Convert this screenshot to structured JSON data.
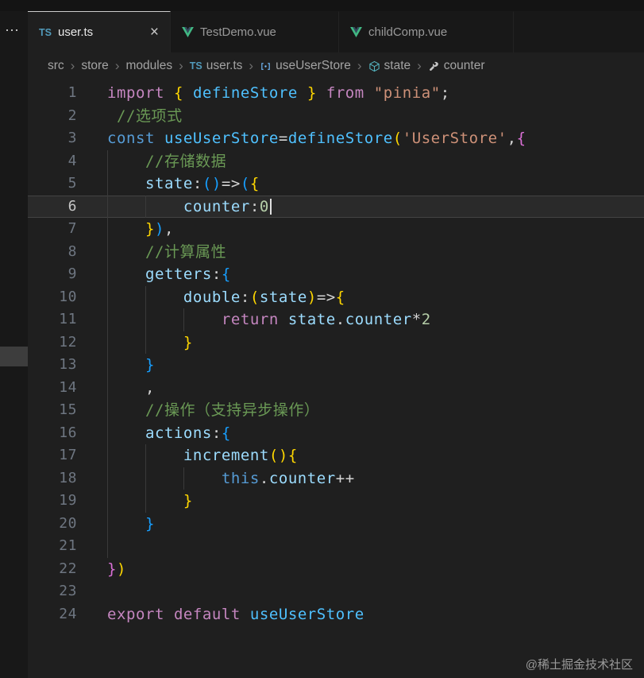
{
  "activity_bar": {
    "overflow_label": "⋯"
  },
  "icons": {
    "ts_label": "TS"
  },
  "tab_bar": {
    "tabs": [
      {
        "label": "user.ts",
        "icon": "ts",
        "active": true,
        "close_label": "×"
      },
      {
        "label": "TestDemo.vue",
        "icon": "vue",
        "active": false
      },
      {
        "label": "childComp.vue",
        "icon": "vue",
        "active": false
      }
    ]
  },
  "breadcrumb": {
    "separator": "›",
    "items": [
      {
        "label": "src"
      },
      {
        "label": "store"
      },
      {
        "label": "modules"
      },
      {
        "label": "user.ts",
        "icon": "ts"
      },
      {
        "label": "useUserStore",
        "icon": "symbol-variable"
      },
      {
        "label": "state",
        "icon": "symbol-cube"
      },
      {
        "label": "counter",
        "icon": "symbol-wrench"
      }
    ]
  },
  "editor": {
    "active_line": 6,
    "lines": [
      {
        "n": 1,
        "t": [
          [
            "kw",
            "import"
          ],
          [
            "pl",
            " "
          ],
          [
            "b1",
            "{"
          ],
          [
            "pl",
            " "
          ],
          [
            "vr",
            "defineStore"
          ],
          [
            "pl",
            " "
          ],
          [
            "b1",
            "}"
          ],
          [
            "pl",
            " "
          ],
          [
            "kw",
            "from"
          ],
          [
            "pl",
            " "
          ],
          [
            "str",
            "\"pinia\""
          ],
          [
            "pl",
            ";"
          ]
        ]
      },
      {
        "n": 2,
        "t": [
          [
            "pl",
            " "
          ],
          [
            "cm",
            "//选项式"
          ]
        ]
      },
      {
        "n": 3,
        "t": [
          [
            "st",
            "const"
          ],
          [
            "pl",
            " "
          ],
          [
            "vr",
            "useUserStore"
          ],
          [
            "pl",
            "="
          ],
          [
            "vr",
            "defineStore"
          ],
          [
            "b1",
            "("
          ],
          [
            "str",
            "'UserStore'"
          ],
          [
            "pl",
            ","
          ],
          [
            "b2",
            "{"
          ]
        ]
      },
      {
        "n": 4,
        "t": [
          [
            "pl",
            "    "
          ],
          [
            "cm",
            "//存储数据"
          ]
        ]
      },
      {
        "n": 5,
        "t": [
          [
            "pl",
            "    "
          ],
          [
            "pr",
            "state"
          ],
          [
            "pl",
            ":"
          ],
          [
            "b3",
            "()"
          ],
          [
            "pl",
            "=>"
          ],
          [
            "b3",
            "("
          ],
          [
            "b1",
            "{"
          ]
        ]
      },
      {
        "n": 6,
        "t": [
          [
            "pl",
            "        "
          ],
          [
            "pr",
            "counter"
          ],
          [
            "pl",
            ":"
          ],
          [
            "num",
            "0"
          ]
        ],
        "cursor": true
      },
      {
        "n": 7,
        "t": [
          [
            "pl",
            "    "
          ],
          [
            "b1",
            "}"
          ],
          [
            "b3",
            ")"
          ],
          [
            "pl",
            ","
          ]
        ]
      },
      {
        "n": 8,
        "t": [
          [
            "pl",
            "    "
          ],
          [
            "cm",
            "//计算属性"
          ]
        ]
      },
      {
        "n": 9,
        "t": [
          [
            "pl",
            "    "
          ],
          [
            "pr",
            "getters"
          ],
          [
            "pl",
            ":"
          ],
          [
            "b3",
            "{"
          ]
        ]
      },
      {
        "n": 10,
        "t": [
          [
            "pl",
            "        "
          ],
          [
            "pr",
            "double"
          ],
          [
            "pl",
            ":"
          ],
          [
            "b1",
            "("
          ],
          [
            "pr",
            "state"
          ],
          [
            "b1",
            ")"
          ],
          [
            "pl",
            "=>"
          ],
          [
            "b1",
            "{"
          ]
        ]
      },
      {
        "n": 11,
        "t": [
          [
            "pl",
            "            "
          ],
          [
            "kw",
            "return"
          ],
          [
            "pl",
            " "
          ],
          [
            "pr",
            "state"
          ],
          [
            "pl",
            "."
          ],
          [
            "pr",
            "counter"
          ],
          [
            "pl",
            "*"
          ],
          [
            "num",
            "2"
          ]
        ]
      },
      {
        "n": 12,
        "t": [
          [
            "pl",
            "        "
          ],
          [
            "b1",
            "}"
          ]
        ]
      },
      {
        "n": 13,
        "t": [
          [
            "pl",
            "    "
          ],
          [
            "b3",
            "}"
          ]
        ]
      },
      {
        "n": 14,
        "t": [
          [
            "pl",
            "    ,"
          ]
        ]
      },
      {
        "n": 15,
        "t": [
          [
            "pl",
            "    "
          ],
          [
            "cm",
            "//操作（支持异步操作）"
          ]
        ]
      },
      {
        "n": 16,
        "t": [
          [
            "pl",
            "    "
          ],
          [
            "pr",
            "actions"
          ],
          [
            "pl",
            ":"
          ],
          [
            "b3",
            "{"
          ]
        ]
      },
      {
        "n": 17,
        "t": [
          [
            "pl",
            "        "
          ],
          [
            "pr",
            "increment"
          ],
          [
            "b1",
            "()"
          ],
          [
            "b1",
            "{"
          ]
        ]
      },
      {
        "n": 18,
        "t": [
          [
            "pl",
            "            "
          ],
          [
            "st",
            "this"
          ],
          [
            "pl",
            "."
          ],
          [
            "pr",
            "counter"
          ],
          [
            "pl",
            "++"
          ]
        ]
      },
      {
        "n": 19,
        "t": [
          [
            "pl",
            "        "
          ],
          [
            "b1",
            "}"
          ]
        ]
      },
      {
        "n": 20,
        "t": [
          [
            "pl",
            "    "
          ],
          [
            "b3",
            "}"
          ]
        ]
      },
      {
        "n": 21,
        "t": []
      },
      {
        "n": 22,
        "t": [
          [
            "b2",
            "}"
          ],
          [
            "b1",
            ")"
          ]
        ]
      },
      {
        "n": 23,
        "t": []
      },
      {
        "n": 24,
        "t": [
          [
            "kw",
            "export"
          ],
          [
            "pl",
            " "
          ],
          [
            "kw",
            "default"
          ],
          [
            "pl",
            " "
          ],
          [
            "vr",
            "useUserStore"
          ]
        ]
      }
    ],
    "guides": [
      {
        "col": 0,
        "from": 4,
        "to": 21
      },
      {
        "col": 4,
        "from": 6,
        "to": 6
      },
      {
        "col": 4,
        "from": 10,
        "to": 12
      },
      {
        "col": 8,
        "from": 11,
        "to": 11
      },
      {
        "col": 4,
        "from": 17,
        "to": 19
      },
      {
        "col": 8,
        "from": 18,
        "to": 18
      }
    ]
  },
  "colors": {
    "kw": "#C586C0",
    "st": "#569CD6",
    "vr": "#4FC1FF",
    "pr": "#9CDCFE",
    "str": "#CE9178",
    "num": "#B5CEA8",
    "cm": "#6A9955",
    "pl": "#D4D4D4",
    "b1": "#FFD700",
    "b2": "#DA70D6",
    "b3": "#179FFF",
    "ts_icon": "#519ABA",
    "vue_green": "#41B883",
    "vue_navy": "#35495E"
  },
  "watermark": "@稀土掘金技术社区"
}
